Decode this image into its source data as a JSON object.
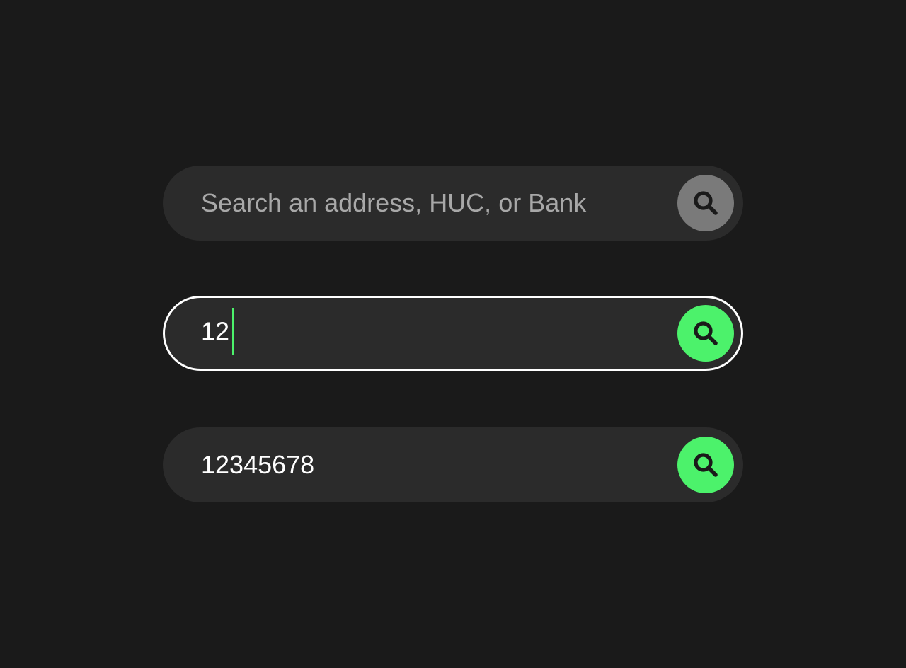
{
  "searches": [
    {
      "state": "empty",
      "placeholder": "Search an address, HUC, or Bank",
      "value": "",
      "button_color": "#7a7a7a"
    },
    {
      "state": "focused",
      "placeholder": "",
      "value": "12",
      "button_color": "#4cf26b",
      "focus_border_color": "#ffffff",
      "caret_color": "#4cf26b"
    },
    {
      "state": "filled",
      "placeholder": "",
      "value": "12345678",
      "button_color": "#4cf26b"
    }
  ],
  "icons": {
    "search_button_icon": "magnifier-icon"
  },
  "colors": {
    "background": "#1a1a1a",
    "field_background": "#2b2b2b",
    "placeholder_text": "#a8a8a8",
    "value_text": "#ffffff",
    "icon_color": "#1a1a1a"
  }
}
